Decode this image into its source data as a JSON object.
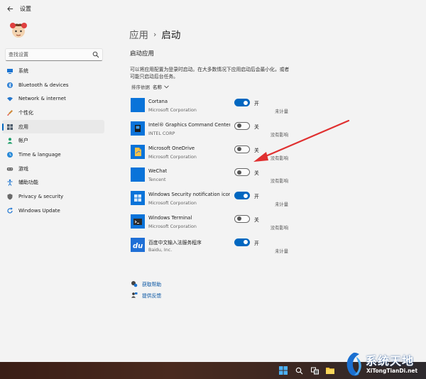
{
  "window": {
    "title": "设置"
  },
  "search": {
    "placeholder": "查找设置"
  },
  "nav": {
    "items": [
      {
        "label": "系统",
        "icon": "monitor-icon"
      },
      {
        "label": "Bluetooth & devices",
        "icon": "bluetooth-icon"
      },
      {
        "label": "Network & internet",
        "icon": "wifi-icon"
      },
      {
        "label": "个性化",
        "icon": "brush-icon"
      },
      {
        "label": "应用",
        "icon": "apps-icon",
        "active": true
      },
      {
        "label": "帐户",
        "icon": "person-icon"
      },
      {
        "label": "Time & language",
        "icon": "globe-clock-icon"
      },
      {
        "label": "游戏",
        "icon": "gamepad-icon"
      },
      {
        "label": "辅助功能",
        "icon": "accessibility-icon"
      },
      {
        "label": "Privacy & security",
        "icon": "shield-icon"
      },
      {
        "label": "Windows Update",
        "icon": "update-icon"
      }
    ]
  },
  "breadcrumb": {
    "parent": "应用",
    "separator": "›",
    "current": "启动"
  },
  "section": {
    "title": "启动应用",
    "description": "可以将应用配置为登录时启动。在大多数情况下应用启动后会最小化，或者可能只启动后台任务。",
    "sort_label": "排序依据",
    "sort_value": "名称"
  },
  "apps": [
    {
      "name": "Cortana",
      "publisher": "Microsoft Corporation",
      "enabled": true,
      "state": "开",
      "impact": "未计量"
    },
    {
      "name": "Intel® Graphics Command Center S...",
      "publisher": "INTEL CORP",
      "enabled": false,
      "state": "关",
      "impact": "没有影响"
    },
    {
      "name": "Microsoft OneDrive",
      "publisher": "Microsoft Corporation",
      "enabled": false,
      "state": "关",
      "impact": "没有影响"
    },
    {
      "name": "WeChat",
      "publisher": "Tencent",
      "enabled": false,
      "state": "关",
      "impact": "没有影响"
    },
    {
      "name": "Windows Security notification icon",
      "publisher": "Microsoft Corporation",
      "enabled": true,
      "state": "开",
      "impact": "未计量"
    },
    {
      "name": "Windows Terminal",
      "publisher": "Microsoft Corporation",
      "enabled": false,
      "state": "关",
      "impact": "没有影响"
    },
    {
      "name": "百度中文输入法服务程序",
      "publisher": "Baidu, Inc.",
      "enabled": true,
      "state": "开",
      "impact": "未计量"
    }
  ],
  "links": {
    "help": "获取帮助",
    "feedback": "提供反馈"
  },
  "watermark": {
    "title": "系统天地",
    "subtitle": "XiTongTianDi.net"
  },
  "colors": {
    "accent": "#0067c0",
    "annotation_arrow": "#e03030"
  }
}
